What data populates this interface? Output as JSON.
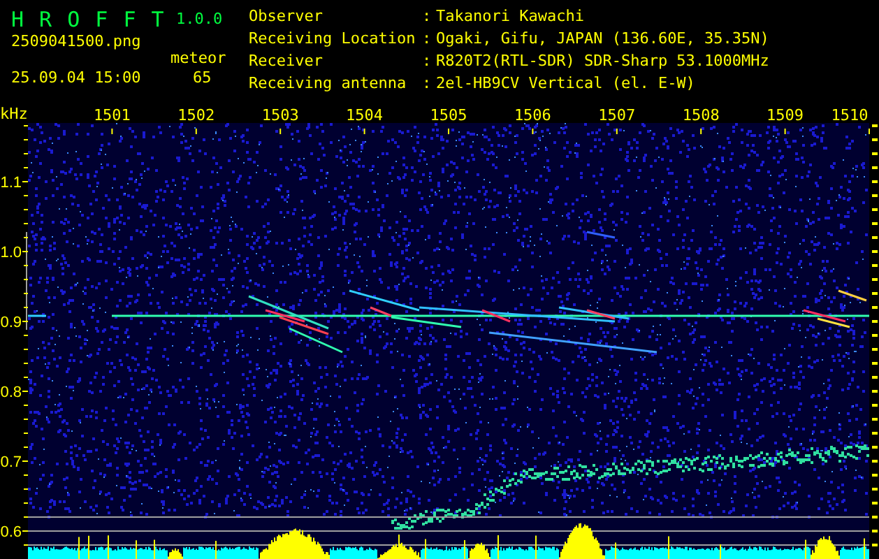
{
  "app": {
    "title": "H R O F F T",
    "version": "1.0.0"
  },
  "file": {
    "filename": "2509041500.png",
    "timestamp": "25.09.04 15:00",
    "category_label": "meteor",
    "count": "65"
  },
  "station": [
    {
      "label": "Observer",
      "separator": ":",
      "value": "Takanori Kawachi"
    },
    {
      "label": "Receiving Location",
      "separator": ":",
      "value": "Ogaki, Gifu, JAPAN (136.60E, 35.35N)"
    },
    {
      "label": "Receiver",
      "separator": ":",
      "value": "R820T2(RTL-SDR) SDR-Sharp 53.1000MHz"
    },
    {
      "label": "Receiving antenna",
      "separator": ":",
      "value": "2el-HB9CV Vertical (el. E-W)"
    }
  ],
  "spectrogram": {
    "unit": "kHz",
    "x_ticks": [
      "1501",
      "1502",
      "1503",
      "1504",
      "1505",
      "1506",
      "1507",
      "1508",
      "1509",
      "1510"
    ],
    "y_ticks": [
      "1.1",
      "1.0",
      "0.9",
      "0.8",
      "0.7",
      "0.6"
    ]
  }
}
